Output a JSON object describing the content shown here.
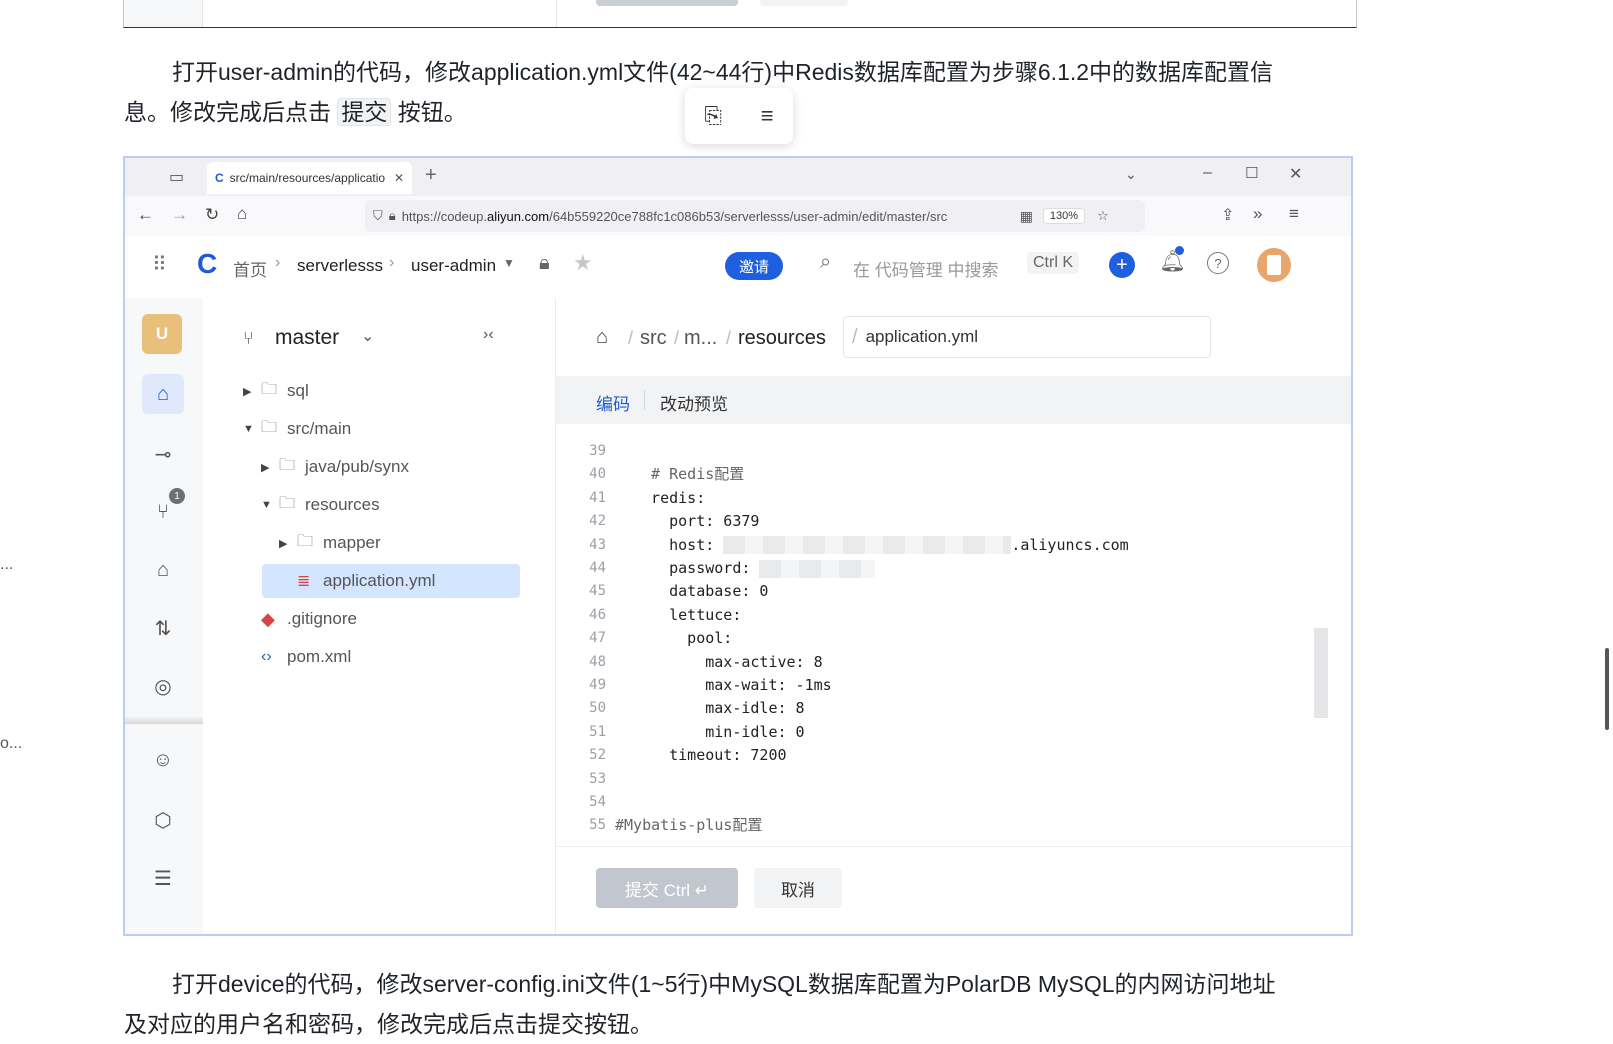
{
  "doc": {
    "para1_line1": "打开user-admin的代码，修改application.yml文件(42~44行)中Redis数据库配置为步骤6.1.2中的数据库配置信",
    "para1_line2_pre": "息。修改完成后点击",
    "para1_kbd": "提交",
    "para1_line2_post": "按钮。",
    "para2_line1": "打开device的代码，修改server-config.ini文件(1~5行)中MySQL数据库配置为PolarDB MySQL的内网访问地址",
    "para2_line2": "及对应的用户名和密码，修改完成后点击提交按钮。",
    "left_ellipsis_1": "...",
    "left_ellipsis_2": "o..."
  },
  "browser": {
    "tab_title": "src/main/resources/applicatio",
    "url_prefix": "https://codeup.",
    "url_domain": "aliyun.com",
    "url_path": "/64b559220ce788fc1c086b53/serverlesss/user-admin/edit/master/src",
    "zoom": "130%"
  },
  "app": {
    "breadcrumb_home": "首页",
    "breadcrumb_org": "serverlesss",
    "breadcrumb_repo": "user-admin",
    "invite_label": "邀请",
    "search_placeholder": "在 代码管理 中搜索",
    "search_shortcut": "Ctrl K",
    "avatar_letter": "U",
    "notification_count": "1"
  },
  "tree": {
    "branch": "master",
    "items": [
      {
        "label": "sql"
      },
      {
        "label": "src/main"
      },
      {
        "label": "java/pub/synx"
      },
      {
        "label": "resources"
      },
      {
        "label": "mapper"
      },
      {
        "label": "application.yml"
      },
      {
        "label": ".gitignore"
      },
      {
        "label": "pom.xml"
      }
    ]
  },
  "editor": {
    "path_src": "src",
    "path_m": "m...",
    "path_resources": "resources",
    "filename": "application.yml",
    "tab_code": "编码",
    "tab_preview": "改动预览",
    "lines": [
      {
        "n": "39",
        "t": ""
      },
      {
        "n": "40",
        "t": "  # Redis配置"
      },
      {
        "n": "41",
        "t": "  redis:"
      },
      {
        "n": "42",
        "t": "    port: 6379"
      },
      {
        "n": "43",
        "t": "    host: "
      },
      {
        "n": "44",
        "t": "    password: "
      },
      {
        "n": "45",
        "t": "    database: 0"
      },
      {
        "n": "46",
        "t": "    lettuce:"
      },
      {
        "n": "47",
        "t": "      pool:"
      },
      {
        "n": "48",
        "t": "        max-active: 8"
      },
      {
        "n": "49",
        "t": "        max-wait: -1ms"
      },
      {
        "n": "50",
        "t": "        max-idle: 8"
      },
      {
        "n": "51",
        "t": "        min-idle: 0"
      },
      {
        "n": "52",
        "t": "    timeout: 7200"
      },
      {
        "n": "53",
        "t": ""
      },
      {
        "n": "54",
        "t": ""
      },
      {
        "n": "55",
        "t": "#Mybatis-plus配置"
      }
    ],
    "host_suffix": ".aliyuncs.com",
    "submit_label": "提交 Ctrl ↵",
    "cancel_label": "取消"
  },
  "colors": {
    "accent": "#1f5bd6",
    "invite_bg": "#1e5fe0",
    "selected_row": "#d4e6ff",
    "submit_disabled": "#c2c7cf"
  }
}
